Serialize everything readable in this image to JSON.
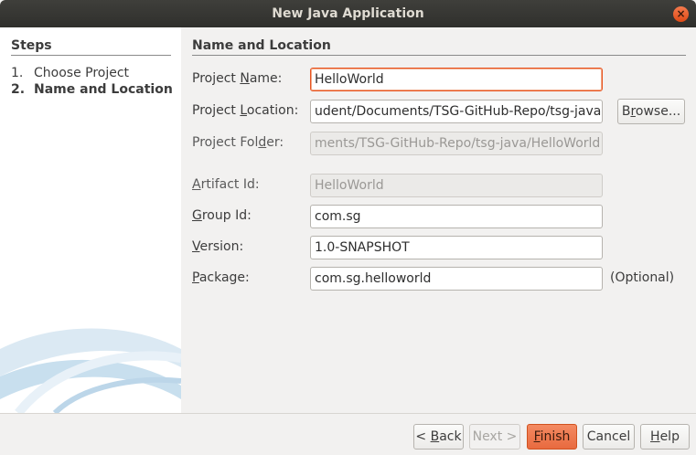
{
  "window": {
    "title": "New Java Application",
    "close_glyph": "×"
  },
  "steps": {
    "heading": "Steps",
    "items": [
      {
        "num": "1.",
        "label": "Choose Project",
        "current": false
      },
      {
        "num": "2.",
        "label": "Name and Location",
        "current": true
      }
    ]
  },
  "section_title": "Name and Location",
  "form": {
    "project_name": {
      "label_pre": "Project ",
      "label_mn": "N",
      "label_post": "ame:",
      "value": "HelloWorld"
    },
    "project_location": {
      "label_pre": "Project ",
      "label_mn": "L",
      "label_post": "ocation:",
      "value": "udent/Documents/TSG-GitHub-Repo/tsg-java"
    },
    "project_folder": {
      "label_pre": "Project Fol",
      "label_mn": "d",
      "label_post": "er:",
      "value": "ments/TSG-GitHub-Repo/tsg-java/HelloWorld"
    },
    "artifact_id": {
      "label_pre": "",
      "label_mn": "A",
      "label_post": "rtifact Id:",
      "value": "HelloWorld"
    },
    "group_id": {
      "label_pre": "",
      "label_mn": "G",
      "label_post": "roup Id:",
      "value": "com.sg"
    },
    "version": {
      "label_pre": "",
      "label_mn": "V",
      "label_post": "ersion:",
      "value": "1.0-SNAPSHOT"
    },
    "package": {
      "label_pre": "",
      "label_mn": "P",
      "label_post": "ackage:",
      "value": "com.sg.helloworld",
      "hint": "(Optional)"
    }
  },
  "buttons": {
    "browse": {
      "pre": "B",
      "mn": "r",
      "post": "owse..."
    },
    "back": {
      "pre": "< ",
      "mn": "B",
      "post": "ack"
    },
    "next": "Next >",
    "finish": {
      "pre": "",
      "mn": "F",
      "post": "inish"
    },
    "cancel": "Cancel",
    "help": {
      "pre": "",
      "mn": "H",
      "post": "elp"
    }
  },
  "colors": {
    "accent": "#e95420",
    "primary_button": "#e86a3f",
    "titlebar": "#3c3b37",
    "panel": "#f2f1f0"
  }
}
